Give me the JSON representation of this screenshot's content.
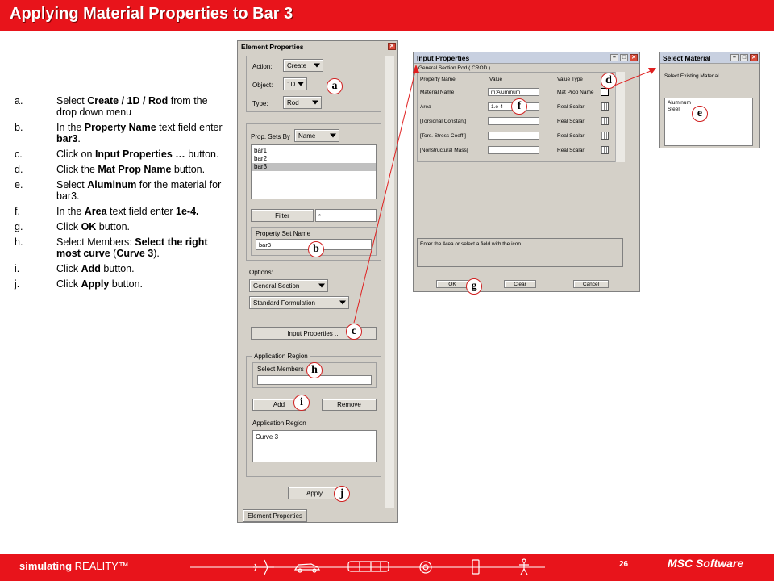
{
  "title": "Applying Material Properties to Bar 3",
  "steps": [
    {
      "letter": "a.",
      "html": "Select <b>Create / 1D / Rod</b> from the drop down menu"
    },
    {
      "letter": "b.",
      "html": "In the <b>Property Name</b> text field enter <b>bar3</b>."
    },
    {
      "letter": "c.",
      "html": "Click on <b>Input Properties … </b>button."
    },
    {
      "letter": "d.",
      "html": "Click the <b>Mat Prop Name</b> button."
    },
    {
      "letter": "e.",
      "html": "Select <b>Aluminum</b> for the material for bar3."
    },
    {
      "letter": "f.",
      "html": "In the <b>Area</b> text field enter <b>1e-4.</b>"
    },
    {
      "letter": "g.",
      "html": "Click <b>OK</b> button."
    },
    {
      "letter": "h.",
      "html": "Select Members: <b>Select the right most curve</b> (<b>Curve 3</b>)."
    },
    {
      "letter": "i.",
      "html": "Click <b>Add</b> button."
    },
    {
      "letter": "j.",
      "html": "Click <b>Apply</b> button."
    }
  ],
  "element_properties": {
    "title": "Element Properties",
    "action_label": "Action:",
    "action_value": "Create",
    "object_label": "Object:",
    "object_value": "1D",
    "type_label": "Type:",
    "type_value": "Rod",
    "prop_sets_label": "Prop. Sets By",
    "prop_sets_value": "Name",
    "prop_sets": [
      "bar1",
      "bar2",
      "bar3"
    ],
    "filter_label": "Filter",
    "filter_value": "*",
    "property_set_name_label": "Property Set Name",
    "property_set_name_value": "bar3",
    "options_label": "Options:",
    "option1": "General Section",
    "option2": "Standard Formulation",
    "input_properties_label": "Input Properties ...",
    "application_region_group": "Application Region",
    "select_members_label": "Select Members",
    "add_label": "Add",
    "remove_label": "Remove",
    "application_region_label": "Application Region",
    "application_region_value": "Curve 3",
    "apply_label": "Apply",
    "tab_label": "Element Properties"
  },
  "input_properties": {
    "title": "Input Properties",
    "subtitle": "General Section Rod ( CROD )",
    "col_property": "Property Name",
    "col_value": "Value",
    "col_type": "Value Type",
    "rows": [
      {
        "name": "Material Name",
        "value": "m:Aluminum",
        "type": "Mat Prop Name"
      },
      {
        "name": "Area",
        "value": "1.e-4",
        "type": "Real Scalar"
      },
      {
        "name": "[Torsional Constant]",
        "value": "",
        "type": "Real Scalar"
      },
      {
        "name": "[Tors. Stress Coeff.]",
        "value": "",
        "type": "Real Scalar"
      },
      {
        "name": "[Nonstructural Mass]",
        "value": "",
        "type": "Real Scalar"
      }
    ],
    "hint": "Enter the Area or select a field with the icon.",
    "ok_label": "OK",
    "clear_label": "Clear",
    "cancel_label": "Cancel"
  },
  "select_material": {
    "title": "Select Material",
    "subtitle": "Select Existing Material",
    "items": [
      "Aluminum",
      "Steel"
    ]
  },
  "callouts": [
    "a",
    "b",
    "c",
    "d",
    "e",
    "f",
    "g",
    "h",
    "i",
    "j"
  ],
  "footer": {
    "brand_bold": "simulating",
    "brand_rest": " REALITY™",
    "page": "26",
    "logo": "MSC Software"
  },
  "colors": {
    "accent": "#e8141b",
    "panel": "#d4d0c8"
  }
}
